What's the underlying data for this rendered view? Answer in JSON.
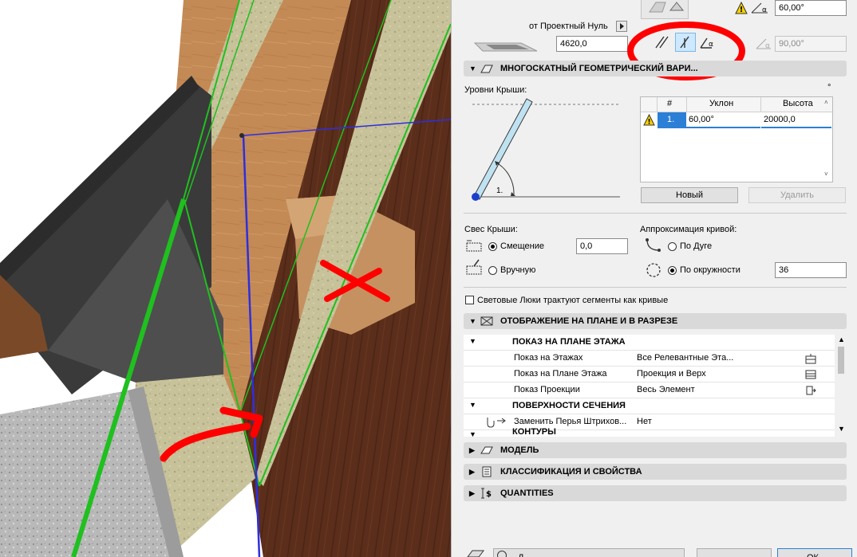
{
  "panel": {
    "top": {
      "angle_value": "60,00°",
      "angle_value_disabled": "90,00°",
      "reference_label": "от Проектный Нуль",
      "elevation_value": "4620,0"
    },
    "multi_plane": {
      "title": "МНОГОСКАТНЫЙ ГЕОМЕТРИЧЕСКИЙ ВАРИ...",
      "roof_levels_label": "Уровни Крыши:",
      "level_marker": "1.",
      "corner_glyph": "°",
      "grid": {
        "headers": [
          "#",
          "Уклон",
          "Высота"
        ],
        "rows": [
          {
            "num": "1.",
            "slope": "60,00°",
            "height": "20000,0"
          }
        ]
      },
      "new_button": "Новый",
      "delete_button": "Удалить"
    },
    "eaves": {
      "label": "Свес Крыши:",
      "offset_label": "Смещение",
      "offset_value": "0,0",
      "manual_label": "Вручную"
    },
    "curve": {
      "label": "Аппроксимация кривой:",
      "by_arc_label": "По Дуге",
      "by_circle_label": "По окружности",
      "segments_value": "36"
    },
    "skylights_checkbox": "Световые Люки трактуют сегменты как кривые",
    "plan_section": {
      "title": "ОТОБРАЖЕНИЕ НА ПЛАНЕ И В РАЗРЕЗЕ",
      "group_floor_plan": "ПОКАЗ НА ПЛАНЕ ЭТАЖА",
      "rows": [
        {
          "label": "Показ на Этажах",
          "value": "Все Релевантные Эта..."
        },
        {
          "label": "Показ на Плане Этажа",
          "value": "Проекция и Верх"
        },
        {
          "label": "Показ Проекции",
          "value": "Весь Элемент"
        }
      ],
      "group_cut_surfaces": "ПОВЕРХНОСТИ СЕЧЕНИЯ",
      "cut_row": {
        "label": "Заменить Перья Штрихов...",
        "value": "Нет"
      },
      "group_outlines": "КОНТУРЫ"
    },
    "sections": [
      {
        "title": "МОДЕЛЬ",
        "icon": "model-icon"
      },
      {
        "title": "КЛАССИФИКАЦИЯ И СВОЙСТВА",
        "icon": "classification-icon"
      },
      {
        "title": "QUANTITIES",
        "icon": "quantities-icon"
      }
    ],
    "footer": {
      "left_initial": "Д",
      "right_button": "ОК"
    }
  },
  "colors": {
    "panel_bg": "#f0f0f0",
    "section_header": "#d9d9d9",
    "selection_blue": "#cde8ff",
    "annotation_red": "#ff0000",
    "green_outline": "#1fc01f",
    "wood_dark": "#5a2f1c",
    "wood_light": "#c8905a"
  }
}
